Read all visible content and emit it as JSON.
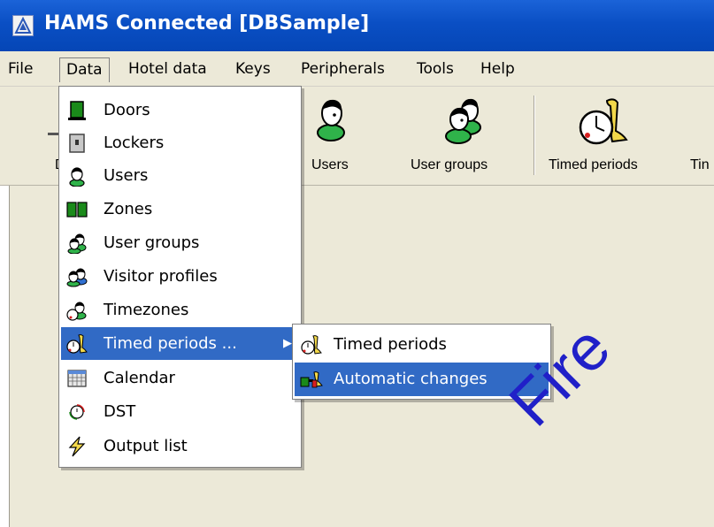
{
  "window": {
    "title": "HAMS Connected [DBSample]"
  },
  "menubar": {
    "items": [
      "File",
      "Data",
      "Hotel data",
      "Keys",
      "Peripherals",
      "Tools",
      "Help"
    ]
  },
  "toolbar": {
    "buttons": [
      {
        "label": "D",
        "icon": "doors-icon"
      },
      {
        "label": "Users",
        "icon": "user-icon"
      },
      {
        "label": "User groups",
        "icon": "user-group-icon"
      },
      {
        "label": "Timed periods",
        "icon": "timed-period-icon"
      },
      {
        "label": "Tin",
        "icon": "timezone-icon"
      }
    ]
  },
  "data_menu": {
    "items": [
      {
        "label": "Doors",
        "icon": "door-icon"
      },
      {
        "label": "Lockers",
        "icon": "locker-icon"
      },
      {
        "label": "Users",
        "icon": "user-icon"
      },
      {
        "label": "Zones",
        "icon": "zones-icon"
      },
      {
        "label": "User groups",
        "icon": "user-group-icon"
      },
      {
        "label": "Visitor profiles",
        "icon": "visitor-profiles-icon"
      },
      {
        "label": "Timezones",
        "icon": "timezone-icon"
      },
      {
        "label": "Timed periods ...",
        "icon": "timed-period-icon",
        "selected": true,
        "has_submenu": true
      },
      {
        "label": "Calendar",
        "icon": "calendar-icon"
      },
      {
        "label": "DST",
        "icon": "dst-icon"
      },
      {
        "label": "Output list",
        "icon": "lightning-icon"
      }
    ]
  },
  "submenu": {
    "items": [
      {
        "label": "Timed periods",
        "icon": "timed-period-icon"
      },
      {
        "label": "Automatic changes",
        "icon": "automatic-changes-icon",
        "selected": true
      }
    ]
  },
  "watermark": "Fire",
  "colors": {
    "titlebar": "#0a4fc4",
    "selection": "#316ac5",
    "menu_bg": "#ece9d8",
    "watermark": "#2020c8"
  }
}
